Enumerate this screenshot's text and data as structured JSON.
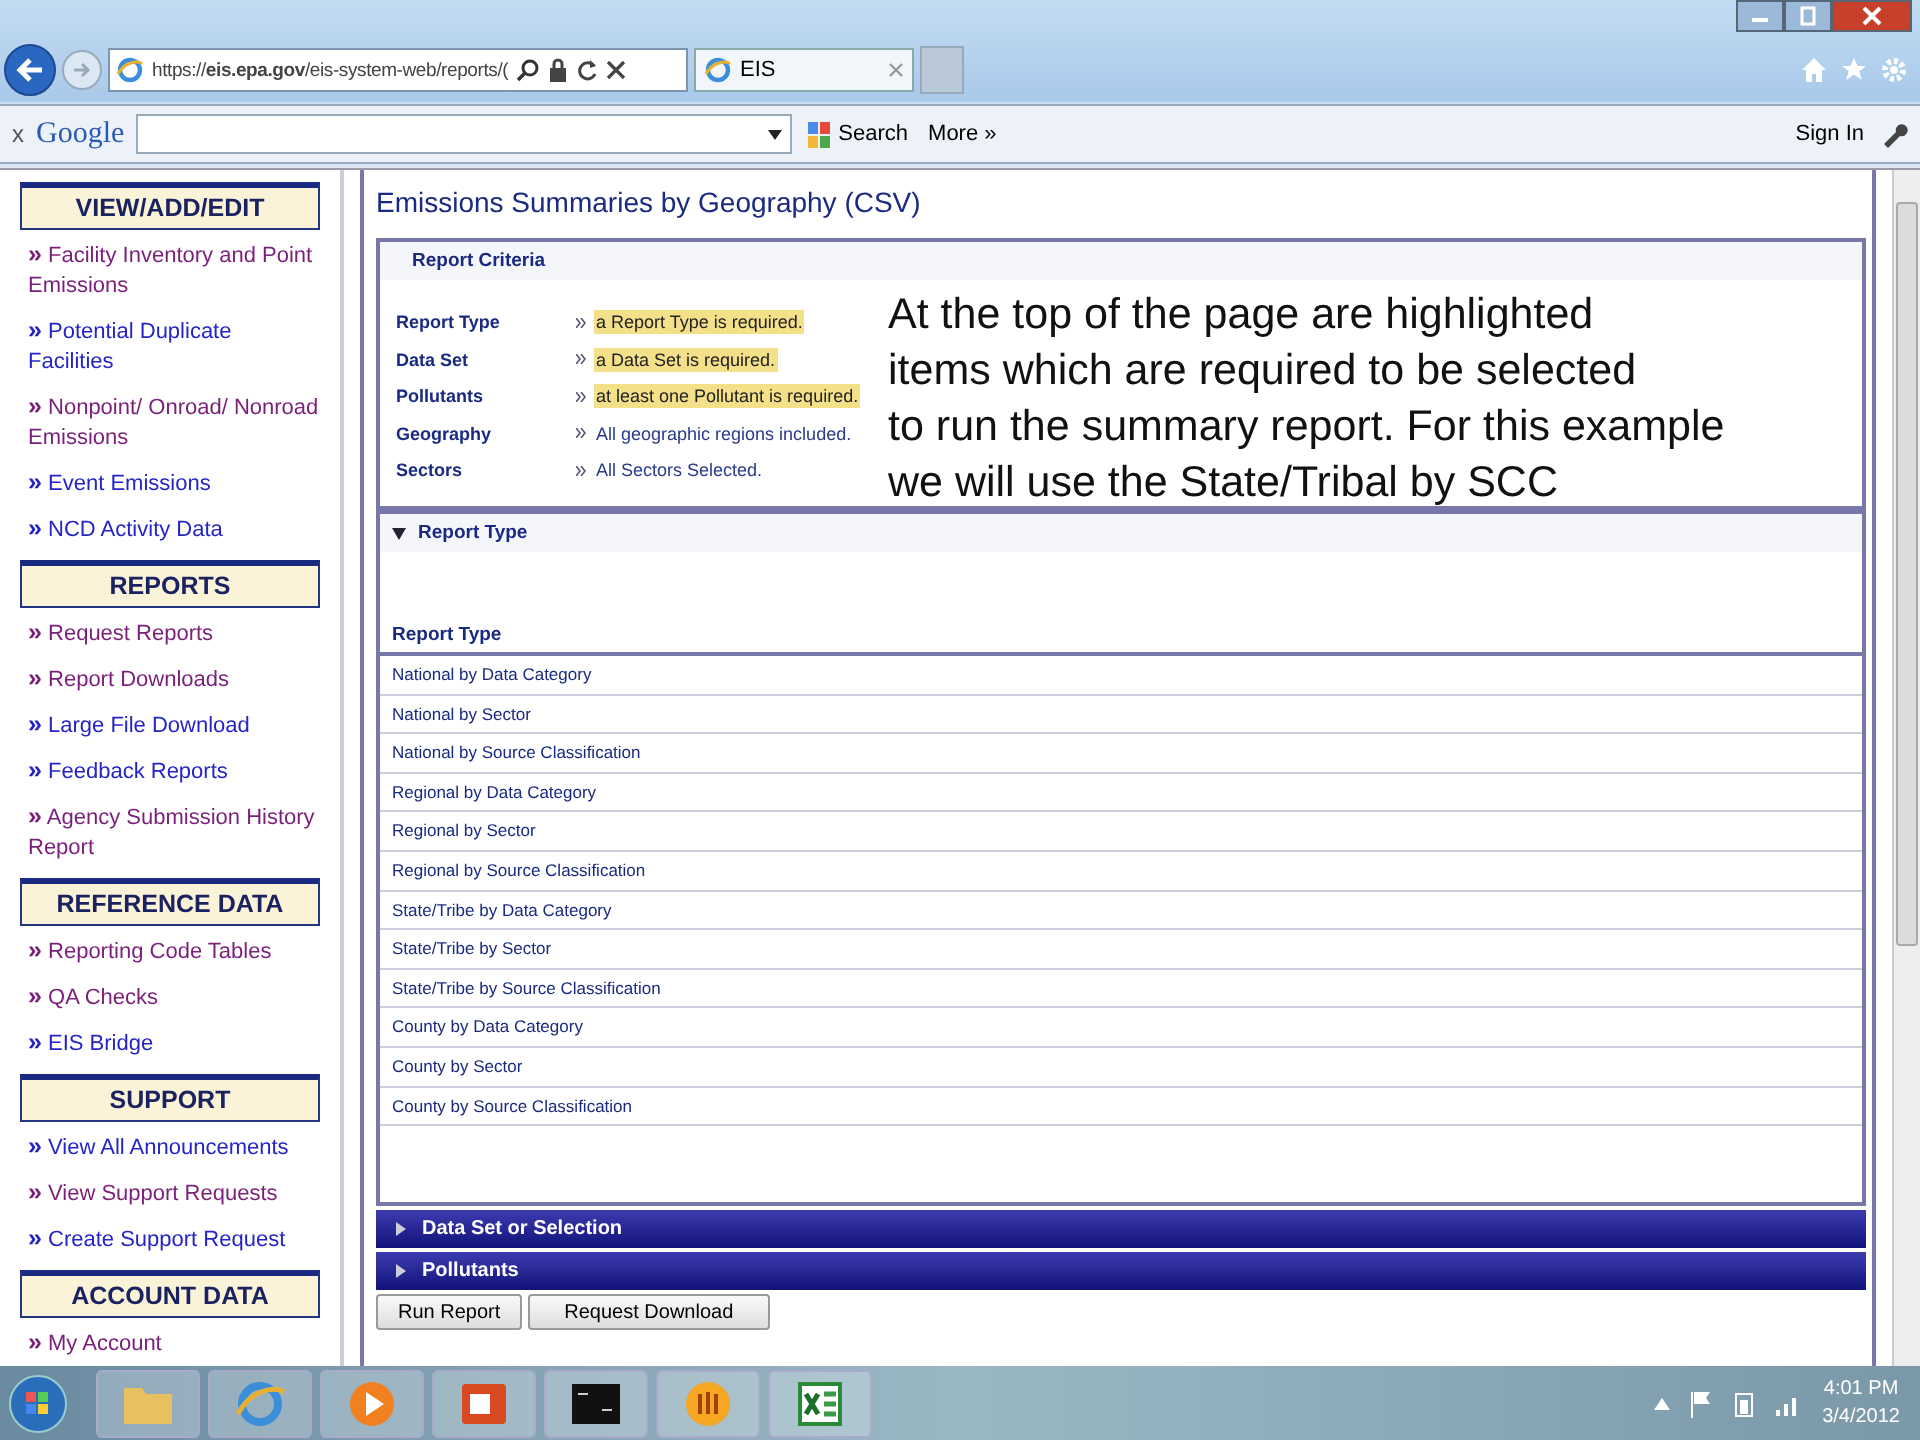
{
  "browser": {
    "url": "https://**eis.epa.gov**/eis-system-web/reports/(",
    "tab_title": "EIS"
  },
  "sidebar_link_marker": "»",
  "google_toolbar": {
    "close": "x",
    "logo": "Google",
    "search": "Search",
    "more": "More »",
    "sign_in": "Sign In"
  },
  "sidebar": [
    {
      "heading": "VIEW/ADD/EDIT",
      "links": [
        {
          "label": "Facility Inventory and Point Emissions",
          "visited": true
        },
        {
          "label": "Potential Duplicate Facilities",
          "visited": false
        },
        {
          "label": "Nonpoint/ Onroad/ Nonroad Emissions",
          "visited": true
        },
        {
          "label": "Event Emissions",
          "visited": false
        },
        {
          "label": "NCD Activity Data",
          "visited": false
        }
      ]
    },
    {
      "heading": "REPORTS",
      "links": [
        {
          "label": "Request Reports",
          "visited": true
        },
        {
          "label": "Report Downloads",
          "visited": true
        },
        {
          "label": "Large File Download",
          "visited": false
        },
        {
          "label": "Feedback Reports",
          "visited": false
        },
        {
          "label": "Agency Submission History Report",
          "visited": true
        }
      ]
    },
    {
      "heading": "REFERENCE DATA",
      "links": [
        {
          "label": "Reporting Code Tables",
          "visited": true
        },
        {
          "label": "QA Checks",
          "visited": true
        },
        {
          "label": "EIS Bridge",
          "visited": false
        }
      ]
    },
    {
      "heading": "SUPPORT",
      "links": [
        {
          "label": "View All Announcements",
          "visited": false
        },
        {
          "label": "View Support Requests",
          "visited": true
        },
        {
          "label": "Create Support Request",
          "visited": false
        }
      ]
    },
    {
      "heading": "ACCOUNT DATA",
      "links": [
        {
          "label": "My Account",
          "visited": true
        }
      ]
    }
  ],
  "page_title": "Emissions Summaries by Geography (CSV)",
  "criteria": {
    "title": "Report Criteria",
    "rows": [
      {
        "label": "Report Type",
        "value": "a Report Type is required.",
        "highlighted": true
      },
      {
        "label": "Data Set",
        "value": "a Data Set is required.",
        "highlighted": true
      },
      {
        "label": "Pollutants",
        "value": "at least one Pollutant is required.",
        "highlighted": true
      },
      {
        "label": "Geography",
        "value": "All geographic regions included.",
        "highlighted": false
      },
      {
        "label": "Sectors",
        "value": "All Sectors Selected.",
        "highlighted": false
      }
    ]
  },
  "annotation": [
    "At the top of the page are highlighted",
    "items which are required to be selected",
    "to run the summary report.  For this example",
    "we will use the State/Tribal by SCC"
  ],
  "panels": [
    {
      "title": "Report Type",
      "expanded": true,
      "column_heading": "Report Type",
      "rows": [
        "National by Data Category",
        "National by Sector",
        "National by Source Classification",
        "Regional by Data Category",
        "Regional by Sector",
        "Regional by Source Classification",
        "State/Tribe by Data Category",
        "State/Tribe by Sector",
        "State/Tribe by Source Classification",
        "County by Data Category",
        "County by Sector",
        "County by Source Classification"
      ]
    },
    {
      "title": "Data Set or Selection",
      "expanded": false
    },
    {
      "title": "Pollutants",
      "expanded": false
    }
  ],
  "buttons": [
    "Run Report",
    "Request Download"
  ],
  "taskbar": {
    "time": "4:01 PM",
    "date": "3/4/2012"
  }
}
